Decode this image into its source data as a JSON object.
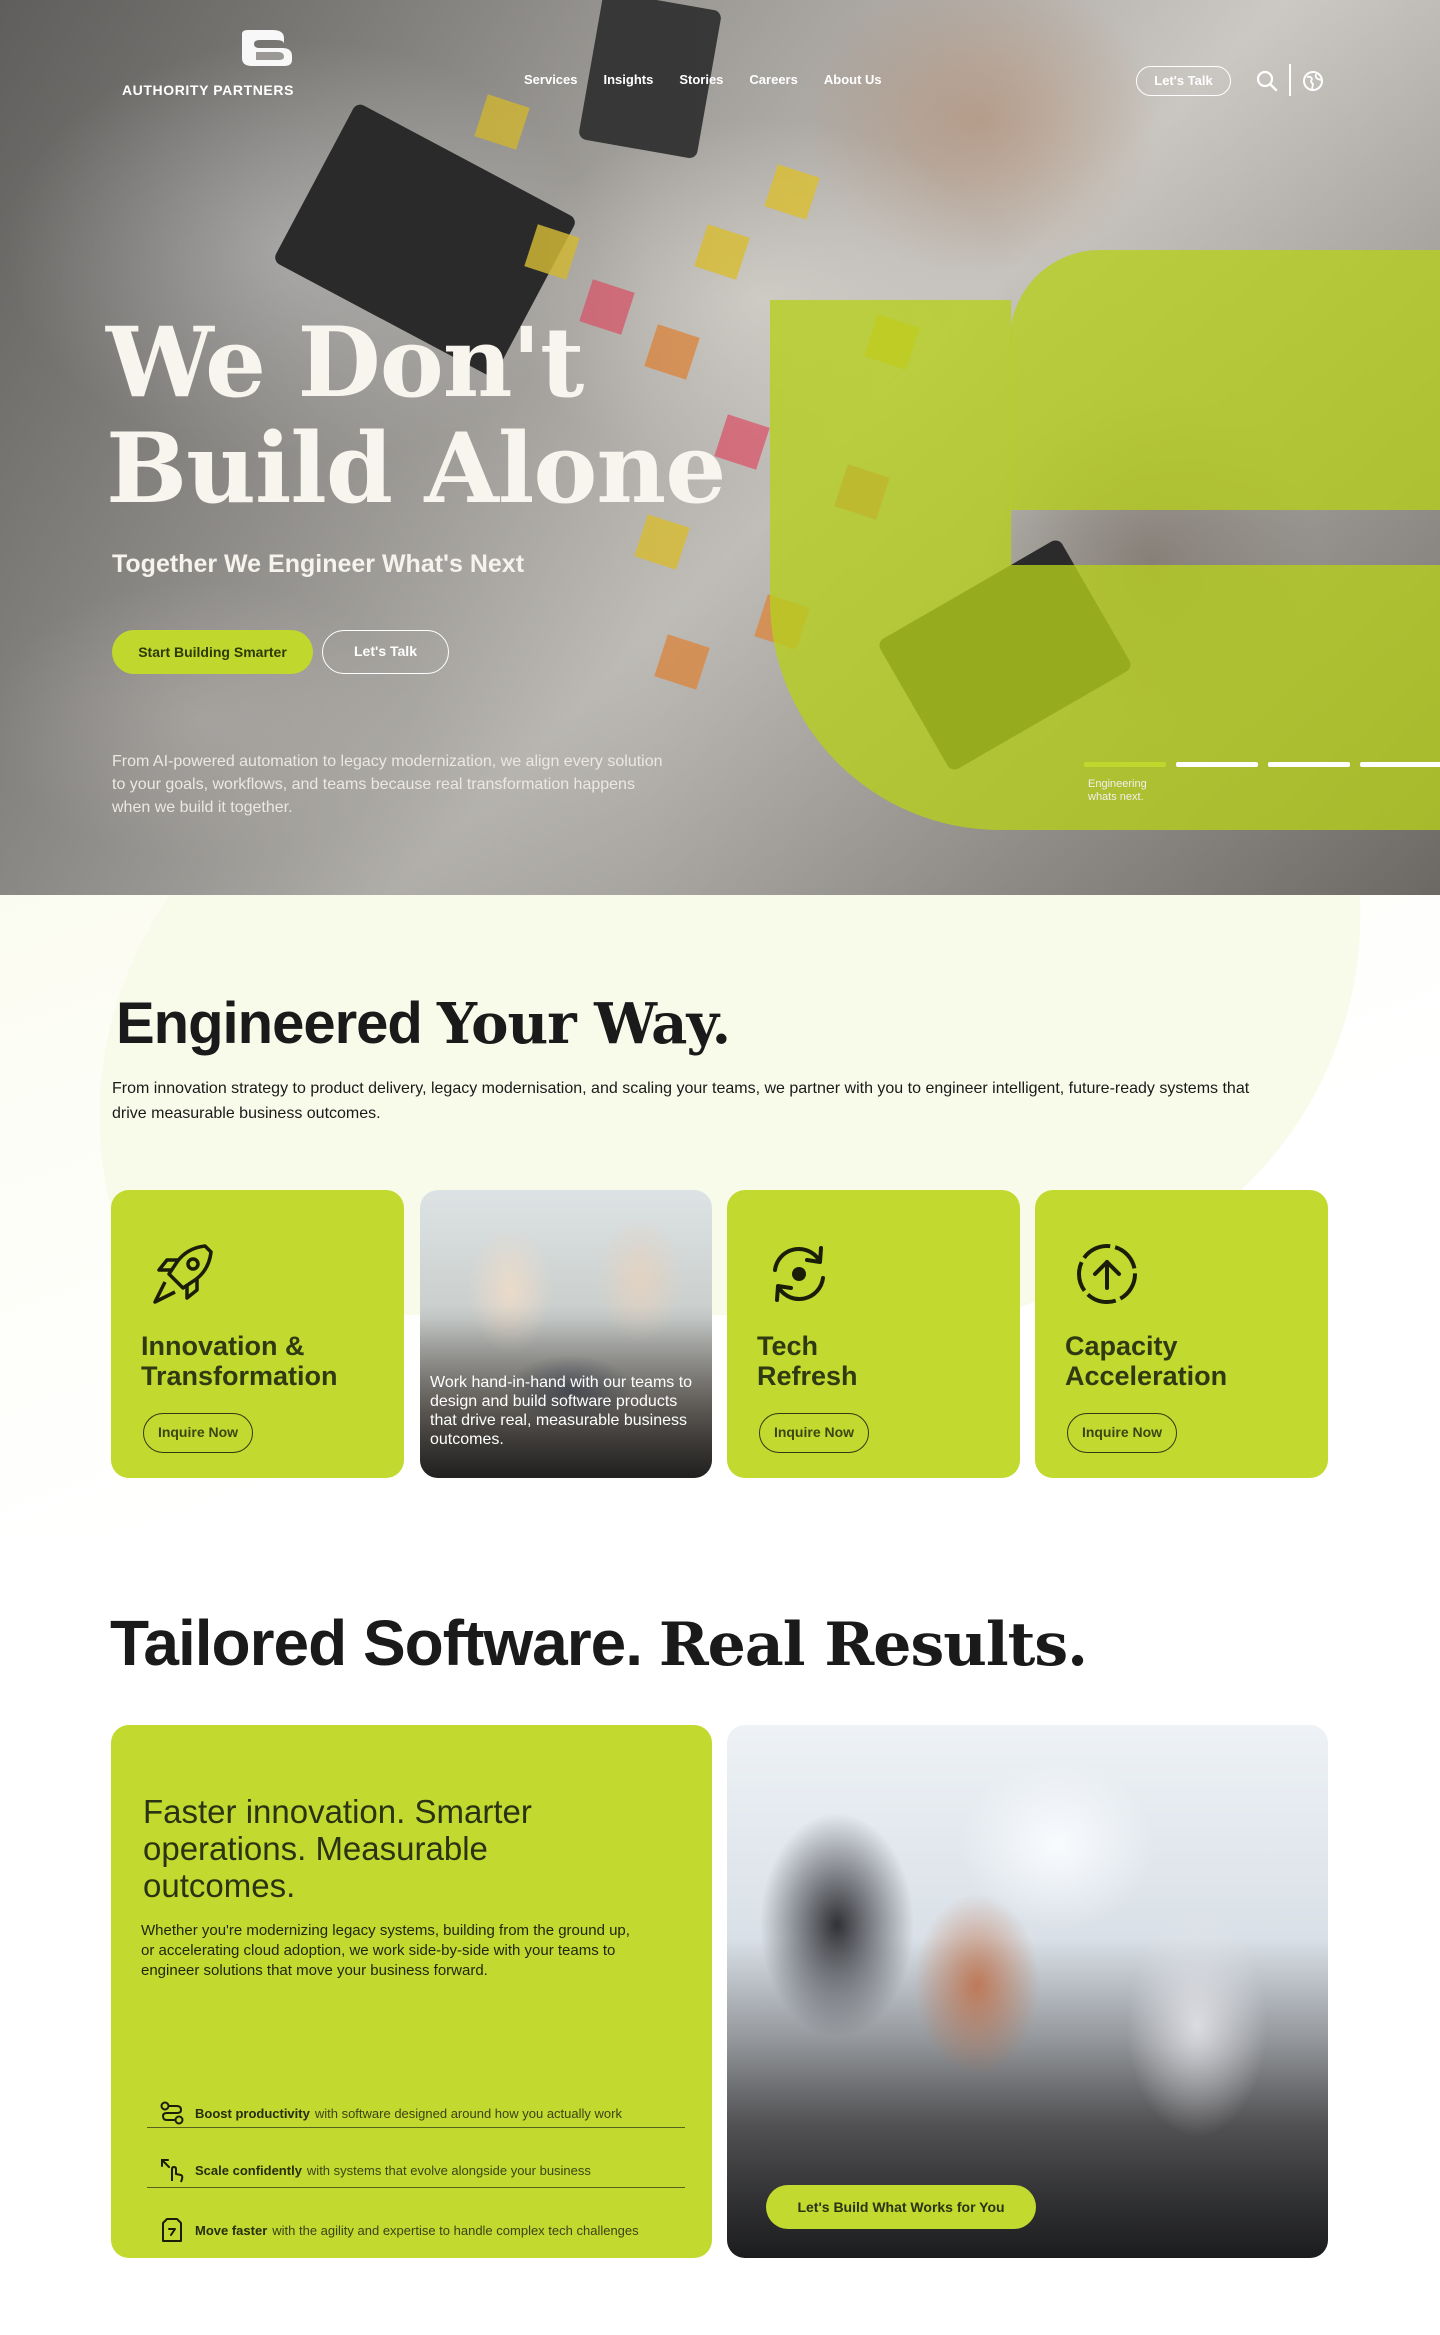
{
  "brand": {
    "logo_text": "AUTHORITY PARTNERS",
    "accent": "#c2d92f",
    "dark": "#2f3a12"
  },
  "nav": {
    "links": [
      "Services",
      "Insights",
      "Stories",
      "Careers",
      "About Us"
    ],
    "cta": "Let's Talk",
    "search_icon": "search-icon",
    "globe_icon": "globe-icon"
  },
  "hero": {
    "title_line1": "We Don't",
    "title_line2": "Build Alone",
    "subtitle": "Together We Engineer What's Next",
    "primary_button": "Start Building Smarter",
    "secondary_button": "Let's Talk",
    "description": "From AI-powered automation to legacy modernization, we align every solution to your goals, workflows, and teams because real transformation happens when we build it together.",
    "slider_caption": "Engineering whats next."
  },
  "engineered": {
    "title_plain": "Engineered ",
    "title_bold": "Your Way.",
    "description": "From innovation strategy to product delivery, legacy modernisation, and scaling your teams, we partner with you to engineer intelligent, future-ready systems that drive measurable business outcomes.",
    "cards": [
      {
        "title": "Innovation & Transformation",
        "button": "Inquire Now",
        "icon": "rocket-icon"
      },
      {
        "photo_text": "Work hand-in-hand with our teams to design and build software products that drive real, measurable business outcomes."
      },
      {
        "title": "Tech Refresh",
        "button": "Inquire Now",
        "icon": "refresh-icon"
      },
      {
        "title": "Capacity Acceleration",
        "button": "Inquire Now",
        "icon": "arrow-up-circle-icon"
      }
    ]
  },
  "tailored": {
    "title_plain": "Tailored Software. ",
    "title_bold": "Real Results.",
    "panel_title": "Faster innovation. Smarter operations. Measurable outcomes.",
    "panel_description": "Whether you're modernizing legacy systems, building from the ground up, or accelerating cloud adoption, we work side-by-side with your teams to engineer solutions that move your business forward.",
    "features": [
      {
        "bold": "Boost productivity",
        "text": "with software designed around how you actually work",
        "icon": "route-icon"
      },
      {
        "bold": "Scale confidently",
        "text": "with systems that evolve alongside your business",
        "icon": "expand-cursor-icon"
      },
      {
        "bold": "Move faster",
        "text": "with the agility and expertise to handle complex tech challenges",
        "icon": "document-icon"
      }
    ],
    "photo_button": "Let's Build What Works for You"
  }
}
